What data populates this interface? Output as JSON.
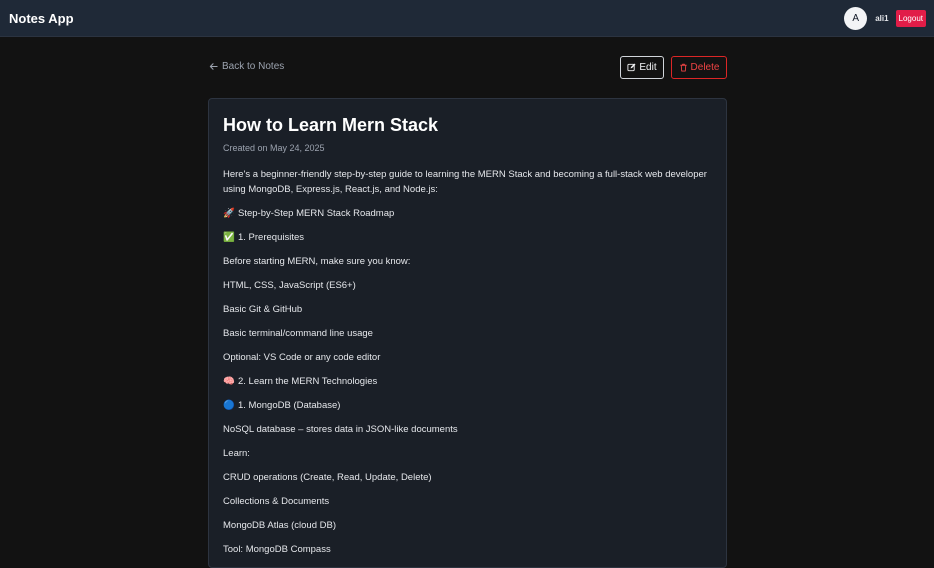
{
  "navbar": {
    "brand": "Notes App",
    "avatar_initial": "A",
    "username": "ali1",
    "logout_label": "Logout"
  },
  "toolbar": {
    "back_label": "Back to Notes",
    "edit_label": "Edit",
    "delete_label": "Delete"
  },
  "note": {
    "title": "How to Learn Mern Stack",
    "created": "Created on May 24, 2025",
    "lines": [
      {
        "emoji": "",
        "text": "Here's a beginner-friendly step-by-step guide to learning the MERN Stack and becoming a full-stack web developer using MongoDB, Express.js, React.js, and Node.js:"
      },
      {
        "emoji": "🚀",
        "text": "Step-by-Step MERN Stack Roadmap"
      },
      {
        "emoji": "✅",
        "text": "1. Prerequisites"
      },
      {
        "emoji": "",
        "text": "Before starting MERN, make sure you know:"
      },
      {
        "emoji": "",
        "text": "HTML, CSS, JavaScript (ES6+)"
      },
      {
        "emoji": "",
        "text": "Basic Git & GitHub"
      },
      {
        "emoji": "",
        "text": "Basic terminal/command line usage"
      },
      {
        "emoji": "",
        "text": "Optional: VS Code or any code editor"
      },
      {
        "emoji": "🧠",
        "text": "2. Learn the MERN Technologies"
      },
      {
        "emoji": "🔵",
        "text": "1. MongoDB (Database)"
      },
      {
        "emoji": "",
        "text": "NoSQL database – stores data in JSON-like documents"
      },
      {
        "emoji": "",
        "text": "Learn:"
      },
      {
        "emoji": "",
        "text": "CRUD operations (Create, Read, Update, Delete)"
      },
      {
        "emoji": "",
        "text": "Collections & Documents"
      },
      {
        "emoji": "",
        "text": "MongoDB Atlas (cloud DB)"
      },
      {
        "emoji": "",
        "text": "Tool: MongoDB Compass"
      }
    ]
  },
  "colors": {
    "accent_danger": "#e11d48",
    "background": "#121212",
    "card": "#1a1f27",
    "navbar": "#1f2937"
  },
  "icons": {
    "back": "arrow-left-icon",
    "edit": "edit-icon",
    "delete": "trash-icon"
  }
}
